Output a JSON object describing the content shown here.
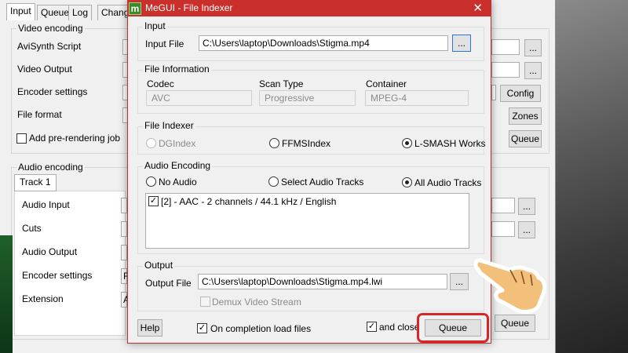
{
  "main": {
    "tabs": [
      {
        "label": "Input"
      },
      {
        "label": "Queue"
      },
      {
        "label": "Log"
      },
      {
        "label": "Chang"
      }
    ],
    "video_group": {
      "title": "Video encoding"
    },
    "video_rows": [
      {
        "label": "AviSynth Script"
      },
      {
        "label": "Video Output"
      },
      {
        "label": "Encoder settings"
      },
      {
        "label": "File format"
      }
    ],
    "pre_render_label": "Add pre-rendering job",
    "buttons": {
      "config": "Config",
      "zones": "Zones",
      "queue_video": "Queue",
      "queue_audio": "Queue",
      "ellipsis": "..."
    },
    "audio_group": {
      "title": "Audio encoding"
    },
    "audio_tab": "Track 1",
    "audio_rows": [
      {
        "label": "Audio Input"
      },
      {
        "label": "Cuts"
      },
      {
        "label": "Audio Output"
      },
      {
        "label": "Encoder settings"
      },
      {
        "label": "Extension"
      }
    ],
    "encoder_partial": "F",
    "extension_partial": "A"
  },
  "dialog": {
    "title": "MeGUI - File Indexer",
    "app_icon_glyph": "m",
    "close_glyph": "✕",
    "input_group": {
      "title": "Input",
      "label": "Input File",
      "value": "C:\\Users\\laptop\\Downloads\\Stigma.mp4",
      "browse": "..."
    },
    "file_info": {
      "title": "File Information",
      "codec_label": "Codec",
      "codec_value": "AVC",
      "scan_label": "Scan Type",
      "scan_value": "Progressive",
      "container_label": "Container",
      "container_value": "MPEG-4"
    },
    "indexer": {
      "title": "File Indexer",
      "options": [
        {
          "label": "DGIndex",
          "selected": false,
          "disabled": true
        },
        {
          "label": "FFMSIndex",
          "selected": false,
          "disabled": false
        },
        {
          "label": "L-SMASH Works",
          "selected": true,
          "disabled": false
        }
      ]
    },
    "audio": {
      "title": "Audio Encoding",
      "options": [
        {
          "label": "No Audio",
          "selected": false
        },
        {
          "label": "Select Audio Tracks",
          "selected": false
        },
        {
          "label": "All Audio Tracks",
          "selected": true
        }
      ],
      "tracks": [
        {
          "label": "[2] - AAC - 2 channels / 44.1 kHz / English",
          "checked": true
        }
      ]
    },
    "output": {
      "title": "Output",
      "label": "Output File",
      "value": "C:\\Users\\laptop\\Downloads\\Stigma.mp4.lwi",
      "browse": "...",
      "demux_label": "Demux Video Stream"
    },
    "footer": {
      "help": "Help",
      "load_label": "On completion load files",
      "close_label": "and close",
      "queue": "Queue"
    }
  },
  "colors": {
    "titlebar": "#c9302c",
    "highlight": "#d5262a",
    "hand_fill": "#f2c07a"
  }
}
